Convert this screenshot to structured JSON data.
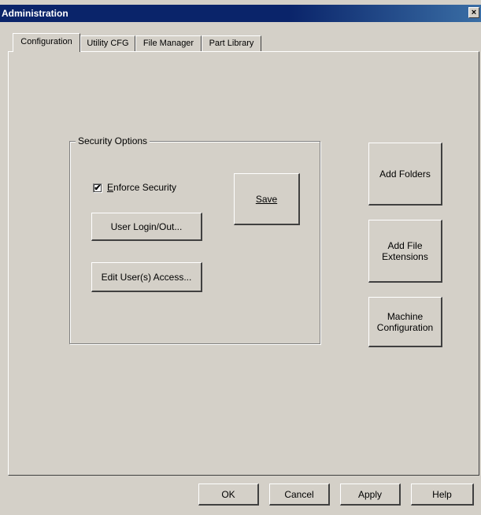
{
  "window": {
    "title": "Administration",
    "close_glyph": "×"
  },
  "tabs": [
    {
      "label": "Configuration",
      "active": true
    },
    {
      "label": "Utility CFG",
      "active": false
    },
    {
      "label": "File Manager",
      "active": false
    },
    {
      "label": "Part Library",
      "active": false
    }
  ],
  "security": {
    "group_label": "Security Options",
    "enforce_checked": true,
    "check_glyph": "✔",
    "enforce_label": "Enforce Security",
    "save_label": "Save",
    "user_login_label": "User Login/Out...",
    "edit_access_label": "Edit User(s) Access..."
  },
  "side_buttons": {
    "add_folders": "Add Folders",
    "add_file_ext_line1": "Add File",
    "add_file_ext_line2": "Extensions",
    "machine_config_line1": "Machine",
    "machine_config_line2": "Configuration"
  },
  "footer": {
    "ok": "OK",
    "cancel": "Cancel",
    "apply": "Apply",
    "help": "Help"
  }
}
